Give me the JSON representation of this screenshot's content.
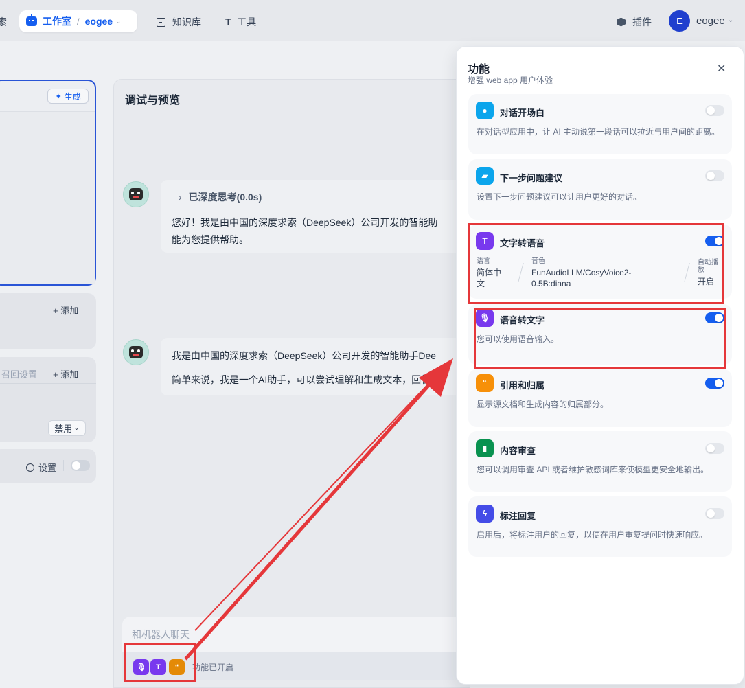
{
  "nav": {
    "cut_text": "索",
    "studio_label": "工作室",
    "separator": "/",
    "workspace_name": "eogee",
    "knowledge_label": "知识库",
    "tools_label": "工具",
    "plugins_label": "插件",
    "avatar_initial": "E",
    "user_name": "eogee"
  },
  "left": {
    "generate_label": "生成",
    "add_label_1": "+ 添加",
    "recall_label": "召回设置",
    "add_label_2": "+ 添加",
    "disable_label": "禁用",
    "settings_label": "设置"
  },
  "preview": {
    "title": "调试与预览",
    "think_label": "已深度思考(0.0s)",
    "msg1_line1": "您好！我是由中国的深度求索（DeepSeek）公司开发的智能助",
    "msg1_line2": "能为您提供帮助。",
    "msg2_line1": "我是由中国的深度求索（DeepSeek）公司开发的智能助手Dee",
    "msg2_line2": "简单来说，我是一个AI助手，可以尝试理解和生成文本，回答问",
    "input_placeholder": "和机器人聊天",
    "features_enabled": "功能已开启"
  },
  "panel": {
    "title": "功能",
    "subtitle": "增强 web app 用户体验",
    "features": [
      {
        "name": "对话开场白",
        "desc": "在对话型应用中，让 AI 主动说第一段话可以拉近与用户间的距离。",
        "enabled": false,
        "color": "#0ba5ec"
      },
      {
        "name": "下一步问题建议",
        "desc": "设置下一步问题建议可以让用户更好的对话。",
        "enabled": false,
        "color": "#0ba5ec"
      },
      {
        "name": "文字转语音",
        "desc": "",
        "enabled": true,
        "color": "#7839ee"
      },
      {
        "name": "语音转文字",
        "desc": "您可以使用语音输入。",
        "enabled": true,
        "color": "#7839ee"
      },
      {
        "name": "引用和归属",
        "desc": "显示源文档和生成内容的归属部分。",
        "enabled": true,
        "color": "#f79009"
      },
      {
        "name": "内容审查",
        "desc": "您可以调用审查 API 或者维护敏感词库来使模型更安全地输出。",
        "enabled": false,
        "color": "#099250"
      },
      {
        "name": "标注回复",
        "desc": "启用后，将标注用户的回复，以便在用户重复提问时快速响应。",
        "enabled": false,
        "color": "#444ce7"
      }
    ],
    "tts": {
      "lang_label": "语言",
      "lang_value_1": "简体中",
      "lang_value_2": "文",
      "voice_label": "音色",
      "voice_value_1": "FunAudioLLM/CosyVoice2-",
      "voice_value_2": "0.5B:diana",
      "auto_label_1": "自动播",
      "auto_label_2": "放",
      "auto_value": "开启"
    }
  },
  "colors": {
    "accent": "#155eef",
    "annotation_red": "#e5373a"
  }
}
